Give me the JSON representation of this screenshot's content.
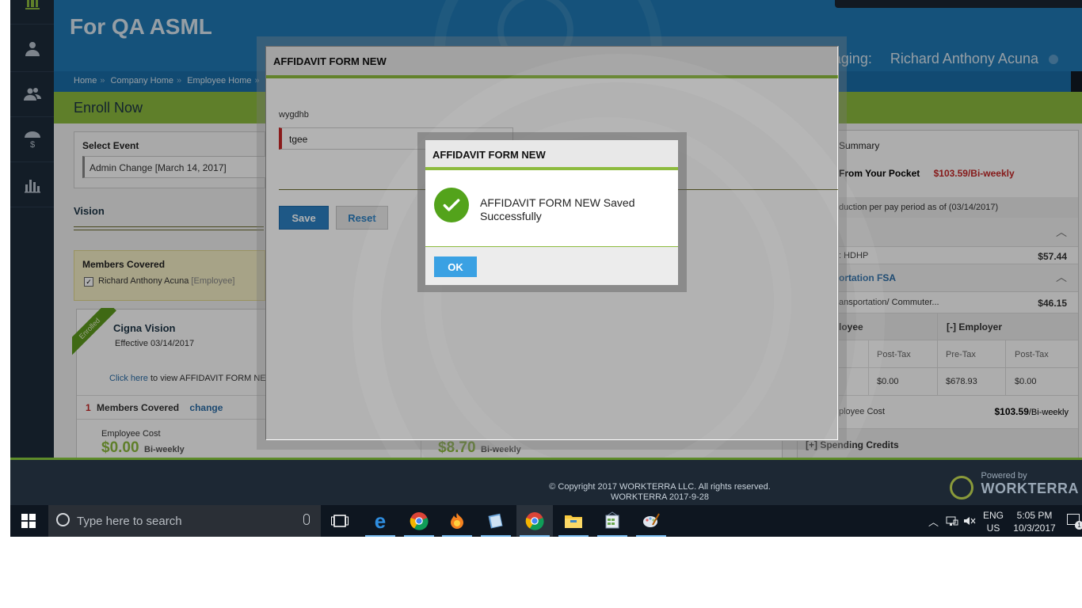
{
  "header": {
    "company_title": "For QA ASML",
    "managing_label": "Managing:",
    "managing_name": "Richard Anthony Acuna"
  },
  "breadcrumb": [
    "Home",
    "Company Home",
    "Employee Home",
    "Be"
  ],
  "page_title": "Enroll Now",
  "select_event": {
    "label": "Select Event",
    "value": "Admin Change [March 14, 2017]"
  },
  "section_title": "Vision",
  "members_covered": {
    "title": "Members Covered",
    "member": "Richard Anthony Acuna",
    "member_role": "[Employee]"
  },
  "plan": {
    "ribbon": "Enrolled",
    "name": "Cigna Vision",
    "effective": "Effective 03/14/2017",
    "link_text": "Click here",
    "link_suffix": " to view AFFIDAVIT FORM NEW",
    "members_count": "1",
    "members_label": "Members Covered",
    "change_label": "change",
    "cost_label": "Employee Cost",
    "cost_value": "$0.00",
    "cost_period": "Bi-weekly",
    "cost_value2": "$8.70",
    "cost_period2": "Bi-weekly"
  },
  "summary": {
    "title": "Summary",
    "pocket_label": "From Your Pocket",
    "pocket_value": "$103.59/Bi-weekly",
    "deduction_note": "duction per pay period as of (03/14/2017)",
    "hdhp_label": ": HDHP",
    "hdhp_value": "$57.44",
    "fsa_title": "ortation FSA",
    "fsa_item": "ansportation/ Commuter...",
    "fsa_value": "$46.15",
    "col_employee": "loyee",
    "col_employer": "[-] Employer",
    "sub_posttax": "Post-Tax",
    "sub_pretax": "Pre-Tax",
    "sub_posttax2": "Post-Tax",
    "val_1": "$0.00",
    "val_2": "$678.93",
    "val_3": "$0.00",
    "employee_cost_label": "ployee Cost",
    "employee_cost_value": "$103.59",
    "employee_cost_period": "/Bi-weekly",
    "spending_credits": "[+] Spending Credits"
  },
  "modal": {
    "title": "AFFIDAVIT FORM NEW",
    "field_label": "wygdhb",
    "field_value": "tgee",
    "save_label": "Save",
    "reset_label": "Reset"
  },
  "alert": {
    "title": "AFFIDAVIT FORM NEW",
    "message": "AFFIDAVIT FORM NEW Saved Successfully",
    "ok_label": "OK"
  },
  "footer": {
    "copyright": "© Copyright 2017 WORKTERRA LLC. All rights reserved.",
    "version": "WORKTERRA 2017-9-28",
    "powered_by": "Powered by",
    "brand": "WORKTERRA"
  },
  "taskbar": {
    "search_placeholder": "Type here to search",
    "lang_1": "ENG",
    "lang_2": "US",
    "time": "5:05 PM",
    "date": "10/3/2017",
    "notif_count": "1"
  },
  "colors": {
    "header_blue": "#1f7ab5",
    "accent_green": "#8dbb3e",
    "nav_dark": "#1d2b3a",
    "error_red": "#c62828",
    "ok_blue": "#3aa1e3",
    "success_green": "#53a31b"
  }
}
